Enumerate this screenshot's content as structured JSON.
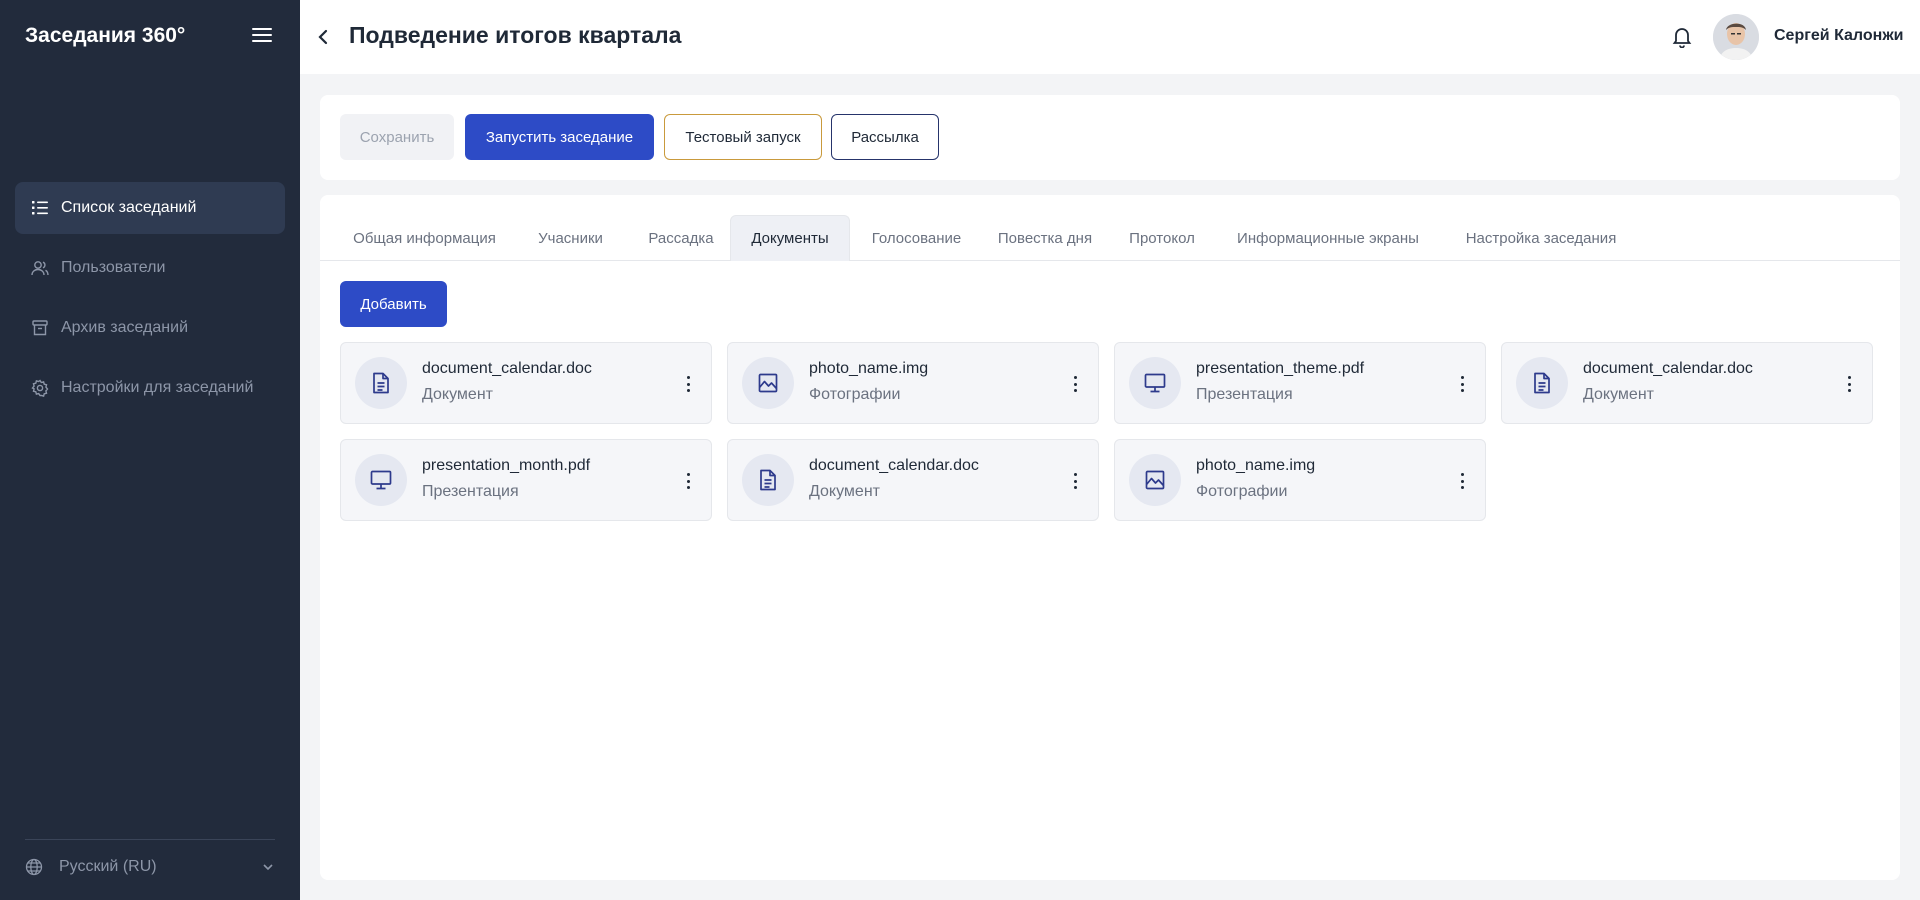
{
  "sidebar": {
    "brand": "Заседания 360°",
    "items": [
      {
        "label": "Список заседаний",
        "icon": "list-icon",
        "active": true
      },
      {
        "label": "Пользователи",
        "icon": "users-icon",
        "active": false
      },
      {
        "label": "Архив заседаний",
        "icon": "archive-icon",
        "active": false
      },
      {
        "label": "Настройки для заседаний",
        "icon": "gear-icon",
        "active": false
      }
    ],
    "language": "Русский (RU)"
  },
  "header": {
    "title": "Подведение итогов квартала",
    "user_name": "Сергей Калонжи"
  },
  "actions": {
    "save": "Сохранить",
    "start": "Запустить заседание",
    "test": "Тестовый запуск",
    "mailing": "Рассылка"
  },
  "tabs": [
    {
      "label": "Общая информация",
      "active": false
    },
    {
      "label": "Учасники",
      "active": false
    },
    {
      "label": "Рассадка",
      "active": false
    },
    {
      "label": "Документы",
      "active": true
    },
    {
      "label": "Голосование",
      "active": false
    },
    {
      "label": "Повестка дня",
      "active": false
    },
    {
      "label": "Протокол",
      "active": false
    },
    {
      "label": "Информационные экраны",
      "active": false
    },
    {
      "label": "Настройка заседания",
      "active": false
    }
  ],
  "documents": {
    "add_label": "Добавить",
    "items": [
      {
        "name": "document_calendar.doc",
        "type": "Документ",
        "icon": "document-icon"
      },
      {
        "name": "photo_name.img",
        "type": "Фотографии",
        "icon": "image-icon"
      },
      {
        "name": "presentation_theme.pdf",
        "type": "Презентация",
        "icon": "monitor-icon"
      },
      {
        "name": "document_calendar.doc",
        "type": "Документ",
        "icon": "document-icon"
      },
      {
        "name": "presentation_month.pdf",
        "type": "Презентация",
        "icon": "monitor-icon"
      },
      {
        "name": "document_calendar.doc",
        "type": "Документ",
        "icon": "document-icon"
      },
      {
        "name": "photo_name.img",
        "type": "Фотографии",
        "icon": "image-icon"
      }
    ]
  },
  "colors": {
    "sidebar_bg": "#222b3c",
    "primary": "#2d4bc6",
    "test_border": "#c99a3c",
    "mail_border": "#26346b"
  }
}
